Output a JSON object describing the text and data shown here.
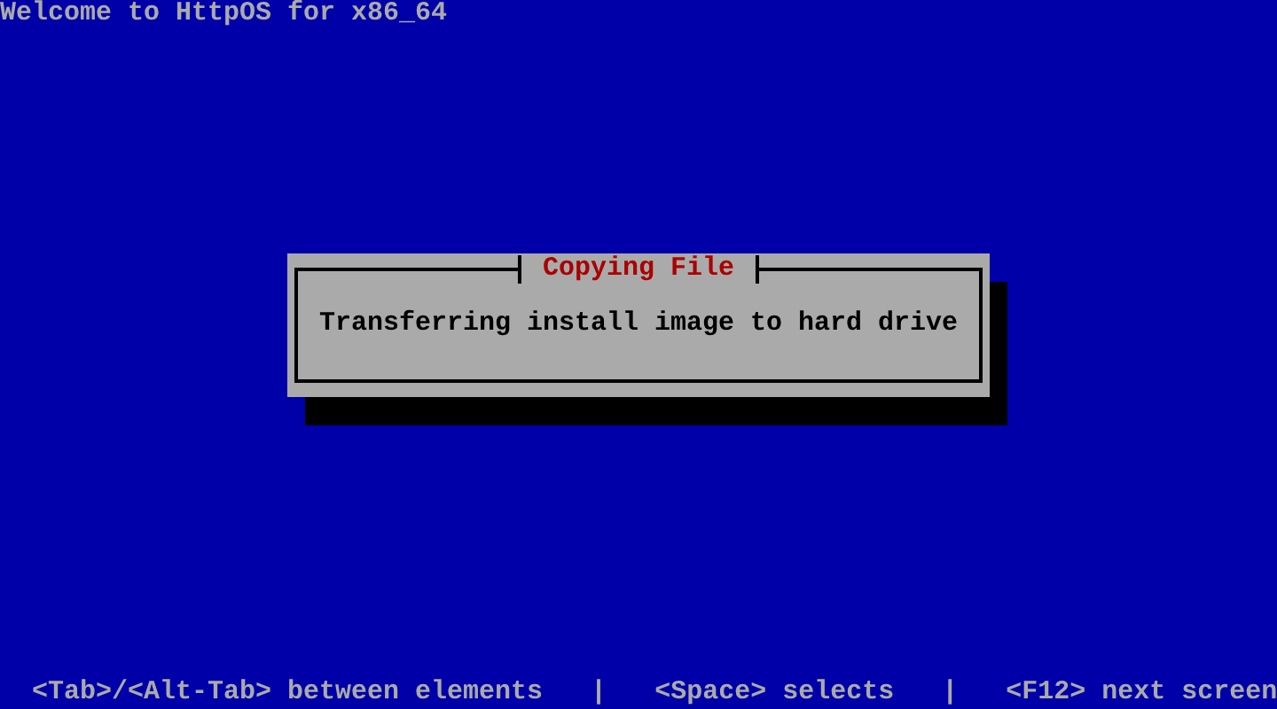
{
  "header": {
    "title": "Welcome to HttpOS for x86_64"
  },
  "dialog": {
    "title": "Copying File",
    "message": "Transferring install image to hard drive"
  },
  "help_line": {
    "items": [
      "<Tab>/<Alt-Tab> between elements",
      "<Space> selects",
      "<F12> next screen"
    ],
    "separator": "|"
  }
}
